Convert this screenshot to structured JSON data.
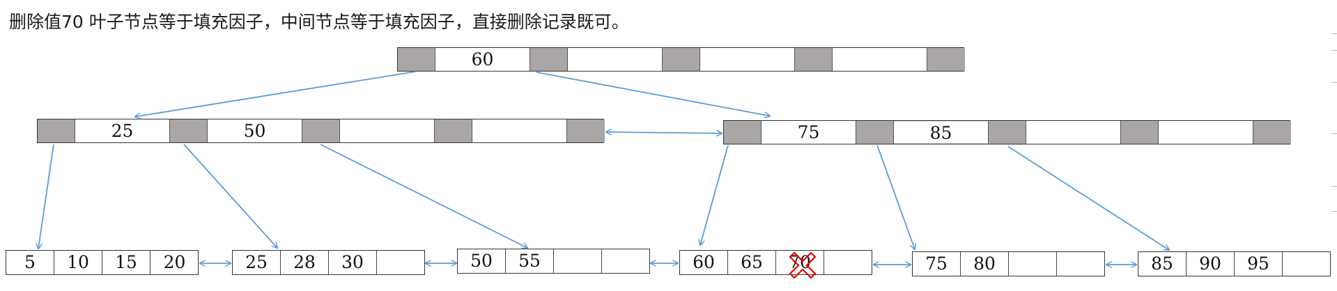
{
  "caption": "删除值70  叶子节点等于填充因子，中间节点等于填充因子，直接删除记录既可。",
  "root": {
    "keys": [
      "60",
      "",
      "",
      ""
    ]
  },
  "internal": [
    {
      "keys": [
        "25",
        "50",
        "",
        ""
      ]
    },
    {
      "keys": [
        "75",
        "85",
        "",
        ""
      ]
    }
  ],
  "leaves": [
    {
      "values": [
        "5",
        "10",
        "15",
        "20"
      ]
    },
    {
      "values": [
        "25",
        "28",
        "30",
        ""
      ]
    },
    {
      "values": [
        "50",
        "55",
        "",
        ""
      ]
    },
    {
      "values": [
        "60",
        "65",
        "70",
        ""
      ]
    },
    {
      "values": [
        "75",
        "80",
        "",
        ""
      ]
    },
    {
      "values": [
        "85",
        "90",
        "95",
        ""
      ]
    }
  ],
  "deleted_value": "70",
  "colors": {
    "pointer": "#aaa6a5",
    "arrow": "#5b9bd5",
    "delete_mark": "#e00000"
  }
}
